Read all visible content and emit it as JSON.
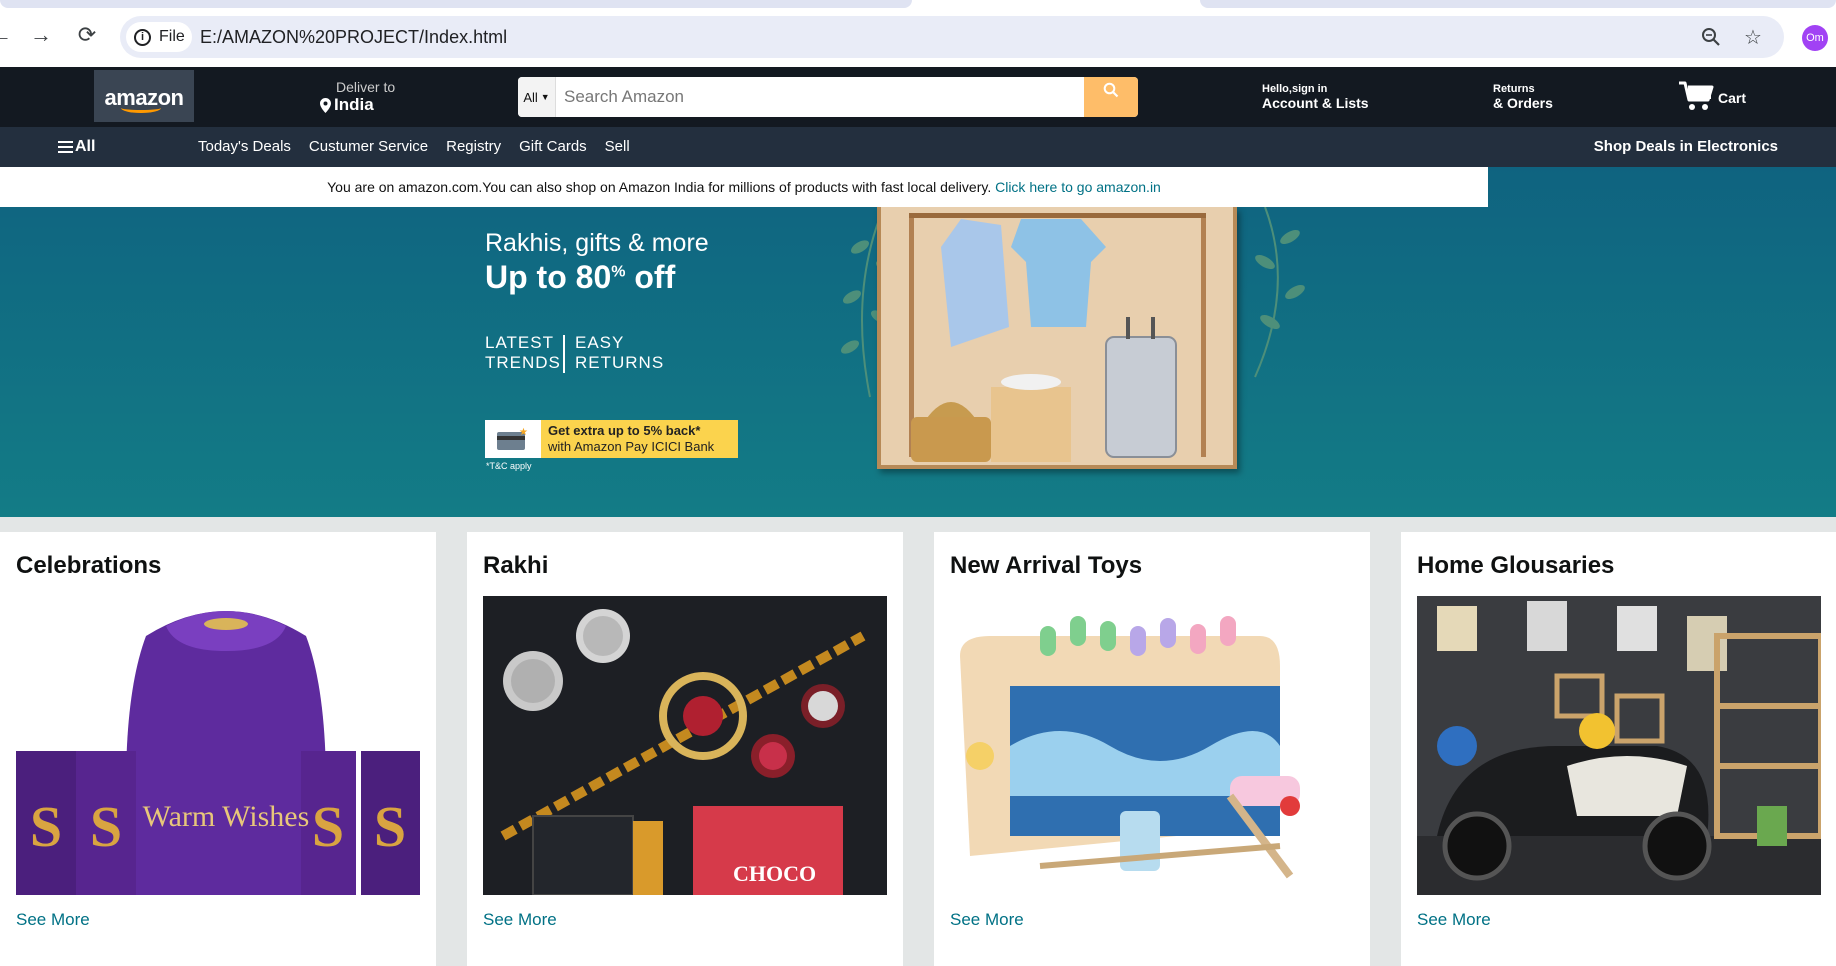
{
  "browser": {
    "site_chip": "File",
    "url": "E:/AMAZON%20PROJECT/Index.html",
    "profile_initials": "Om"
  },
  "header": {
    "logo_text": "amazon",
    "deliver_label": "Deliver to",
    "deliver_location": "India",
    "search_category": "All",
    "search_placeholder": "Search Amazon",
    "account_greeting": "Hello,sign in",
    "account_label": "Account & Lists",
    "returns_label": "Returns",
    "orders_label": "& Orders",
    "cart_label": "Cart"
  },
  "subnav": {
    "all_label": "All",
    "links": [
      "Today's Deals",
      "Custumer Service",
      "Registry",
      "Gift Cards",
      "Sell"
    ],
    "shop_deals": "Shop Deals in Electronics"
  },
  "notice": {
    "text": "You are on amazon.com.You can also shop on Amazon India for millions of products with fast local delivery.",
    "link": "Click here to go amazon.in"
  },
  "hero": {
    "line1": "Rakhis, gifts & more",
    "line2": "Up to 80",
    "line2_sup": "%",
    "line2_tail": " off",
    "feature1_a": "LATEST",
    "feature1_b": "TRENDS",
    "feature2_a": "EASY",
    "feature2_b": "RETURNS",
    "promo_line1": "Get extra up to 5% back*",
    "promo_line2": "with Amazon Pay ICICI Bank",
    "tnc": "*T&C apply"
  },
  "cards": [
    {
      "title": "Celebrations",
      "link": "See More",
      "image_text": "Warm Wishes"
    },
    {
      "title": "Rakhi",
      "link": "See More"
    },
    {
      "title": "New Arrival Toys",
      "link": "See More"
    },
    {
      "title": "Home Glousaries",
      "link": "See More"
    }
  ],
  "colors": {
    "nav_main": "#131921",
    "nav_sub": "#232f3e",
    "search_button": "#febd69",
    "link": "#007185",
    "hero": "#137c86"
  }
}
